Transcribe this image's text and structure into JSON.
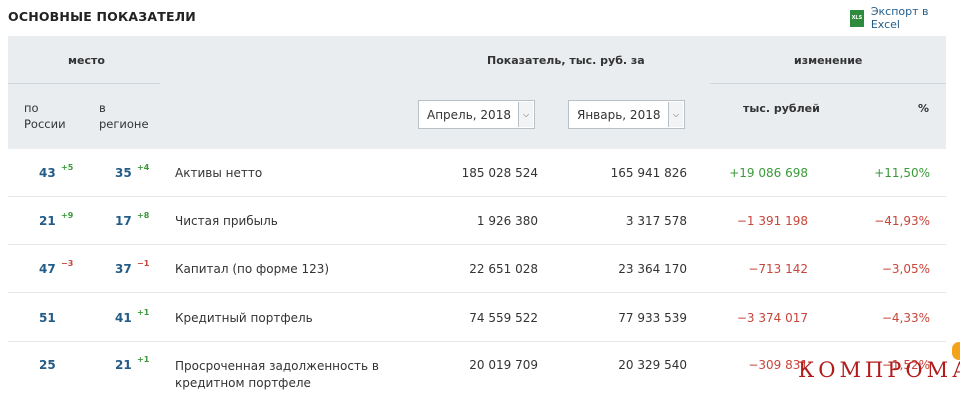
{
  "title": "ОСНОВНЫЕ ПОКАЗАТЕЛИ",
  "export": {
    "label": "Экспорт в Excel",
    "icon_text": "XLS",
    "icon": "excel-icon"
  },
  "headers": {
    "place": "место",
    "indicator": "Показатель, тыс. руб. за",
    "change": "изменение",
    "by_russia_1": "по",
    "by_russia_2": "России",
    "in_region_1": "в",
    "in_region_2": "регионе",
    "thousand_rub": "тыс. рублей",
    "percent": "%"
  },
  "selects": {
    "period1": "Апрель, 2018",
    "period2": "Январь, 2018"
  },
  "rows": [
    {
      "rank_russia": "43",
      "rank_russia_delta": "+5",
      "rank_region": "35",
      "rank_region_delta": "+4",
      "name_line1": "Активы нетто",
      "name_line2": "",
      "value1": "185 028 524",
      "value2": "165 941 826",
      "change_abs": "+19 086 698",
      "change_pct": "+11,50%"
    },
    {
      "rank_russia": "21",
      "rank_russia_delta": "+9",
      "rank_region": "17",
      "rank_region_delta": "+8",
      "name_line1": "Чистая прибыль",
      "name_line2": "",
      "value1": "1 926 380",
      "value2": "3 317 578",
      "change_abs": "−1 391 198",
      "change_pct": "−41,93%"
    },
    {
      "rank_russia": "47",
      "rank_russia_delta": "−3",
      "rank_region": "37",
      "rank_region_delta": "−1",
      "name_line1": "Капитал (по форме 123)",
      "name_line2": "",
      "value1": "22 651 028",
      "value2": "23 364 170",
      "change_abs": "−713 142",
      "change_pct": "−3,05%"
    },
    {
      "rank_russia": "51",
      "rank_russia_delta": "",
      "rank_region": "41",
      "rank_region_delta": "+1",
      "name_line1": "Кредитный портфель",
      "name_line2": "",
      "value1": "74 559 522",
      "value2": "77 933 539",
      "change_abs": "−3 374 017",
      "change_pct": "−4,33%"
    },
    {
      "rank_russia": "25",
      "rank_russia_delta": "",
      "rank_region": "21",
      "rank_region_delta": "+1",
      "name_line1": "Просроченная задолженность в",
      "name_line2": "кредитном портфеле",
      "value1": "20 019 709",
      "value2": "20 329 540",
      "change_abs": "−309 831",
      "change_pct": "−1,52%"
    }
  ],
  "colors": {
    "positive": "#3a9a3a",
    "negative": "#c8453a",
    "rank": "#245c88",
    "header_bg": "#e9edf0"
  },
  "watermark": "КОМПРОМАТ"
}
